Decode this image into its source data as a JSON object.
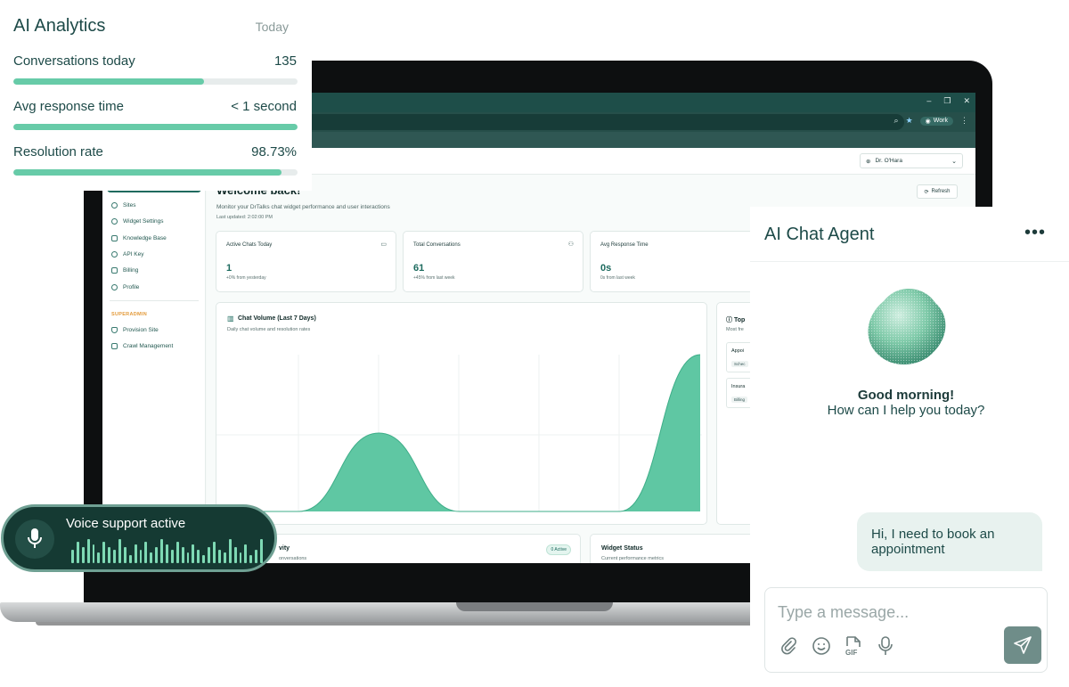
{
  "analytics": {
    "title": "AI Analytics",
    "period": "Today",
    "metrics": [
      {
        "label": "Conversations today",
        "value": "135",
        "progress": 0.67
      },
      {
        "label": "Avg response time",
        "value": "< 1 second",
        "progress": 1.0
      },
      {
        "label": "Resolution rate",
        "value": "98.73%",
        "progress": 0.945
      }
    ]
  },
  "browser": {
    "profile_label": "Work"
  },
  "sidebar": {
    "items": [
      {
        "label": "Sites",
        "icon": "globe-icon"
      },
      {
        "label": "Widget Settings",
        "icon": "gear-icon"
      },
      {
        "label": "Knowledge Base",
        "icon": "book-icon"
      },
      {
        "label": "API Key",
        "icon": "key-icon"
      },
      {
        "label": "Billing",
        "icon": "card-icon"
      },
      {
        "label": "Profile",
        "icon": "user-icon"
      }
    ],
    "section_label": "SUPERADMIN",
    "admin_items": [
      {
        "label": "Provision Site",
        "icon": "shield-icon"
      },
      {
        "label": "Crawl Management",
        "icon": "database-icon"
      }
    ]
  },
  "header": {
    "user": "Dr. O'Hara",
    "welcome": "Welcome back!",
    "subtitle": "Monitor your DrTalks chat widget performance and user interactions",
    "last_updated": "Last updated: 2:02:00 PM",
    "refresh_label": "Refresh"
  },
  "stats": [
    {
      "label": "Active Chats Today",
      "value": "1",
      "sub": "+0% from yesterday",
      "icon": "chat-icon"
    },
    {
      "label": "Total Conversations",
      "value": "61",
      "sub": "+45% from last week",
      "icon": "users-icon"
    },
    {
      "label": "Avg Response Time",
      "value": "0s",
      "sub": "0s from last week",
      "icon": "clock-icon"
    }
  ],
  "volume_chart": {
    "title": "Chat Volume (Last 7 Days)",
    "subtitle": "Daily chat volume and resolution rates"
  },
  "chart_data": {
    "type": "area",
    "title": "Chat Volume (Last 7 Days)",
    "x": [
      0,
      1,
      2,
      3,
      4,
      5,
      6
    ],
    "series": [
      {
        "values": [
          0,
          0,
          0.5,
          0,
          0,
          0,
          1
        ]
      }
    ],
    "ylim": [
      0,
      1
    ],
    "grid": true,
    "color": "#5fc7a3"
  },
  "topics": {
    "title": "Top",
    "subtitle": "Most fre",
    "items": [
      {
        "title": "Appoi",
        "badge": "Schec"
      },
      {
        "title": "Insura",
        "badge": "Billing"
      }
    ]
  },
  "activity": {
    "title": "vity",
    "subtitle": "onversations",
    "badge": "0 Active"
  },
  "widget_status": {
    "title": "Widget Status",
    "subtitle": "Current performance metrics"
  },
  "voice": {
    "label": "Voice support active",
    "levels": [
      0.5,
      0.8,
      0.6,
      0.9,
      0.7,
      0.4,
      0.8,
      0.6,
      0.5,
      0.9,
      0.6,
      0.3,
      0.7,
      0.5,
      0.8,
      0.4,
      0.6,
      0.9,
      0.7,
      0.5,
      0.8,
      0.6,
      0.4,
      0.7,
      0.5,
      0.3,
      0.6,
      0.8,
      0.5,
      0.4,
      0.9,
      0.6,
      0.4,
      0.7,
      0.3,
      0.5,
      0.9
    ]
  },
  "chat": {
    "title": "AI Chat Agent",
    "greeting": "Good morning!",
    "prompt": "How can I help you today?",
    "user_message": "Hi, I need to book an appointment",
    "input_placeholder": "Type a message..."
  },
  "colors": {
    "accent": "#67cba8",
    "brand_dark": "#1d4a48",
    "voice_bg": "#153a33"
  }
}
